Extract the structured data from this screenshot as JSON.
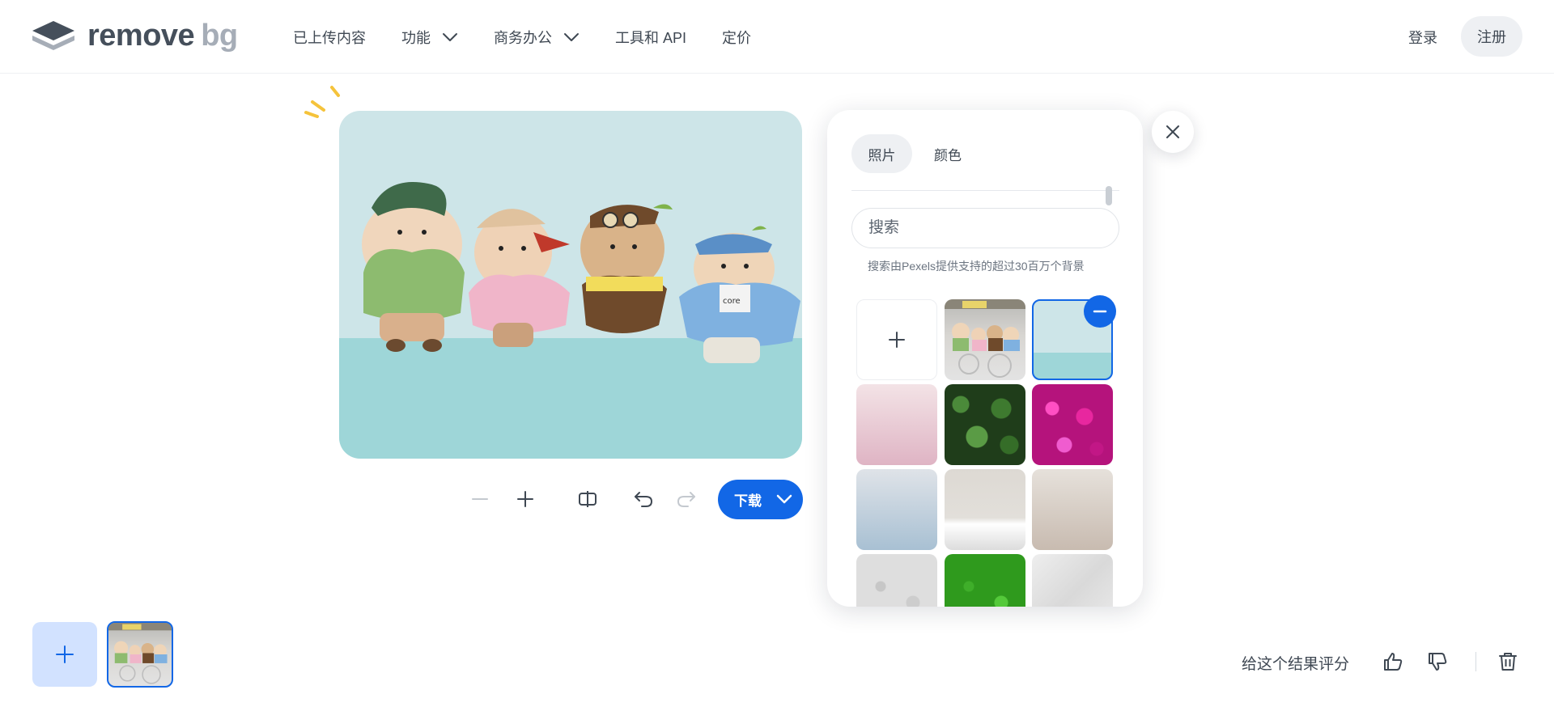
{
  "brand": {
    "logo_word1": "remove",
    "logo_word2": "bg"
  },
  "nav": {
    "uploads": "已上传内容",
    "features": "功能",
    "business": "商务办公",
    "tools_api": "工具和 API",
    "pricing": "定价"
  },
  "account": {
    "login": "登录",
    "signup": "注册"
  },
  "toolbar": {
    "download_label": "下载"
  },
  "panel": {
    "tabs": [
      {
        "label": "照片",
        "active": true
      },
      {
        "label": "颜色",
        "active": false
      }
    ],
    "search": {
      "placeholder": "搜索",
      "value": ""
    },
    "search_note": "搜索由Pexels提供支持的超过30百万个背景"
  },
  "feedback": {
    "rate_label": "给这个结果评分"
  },
  "colors": {
    "accent": "#1267e6",
    "text": "#3f4853",
    "muted": "#a6adb7"
  }
}
